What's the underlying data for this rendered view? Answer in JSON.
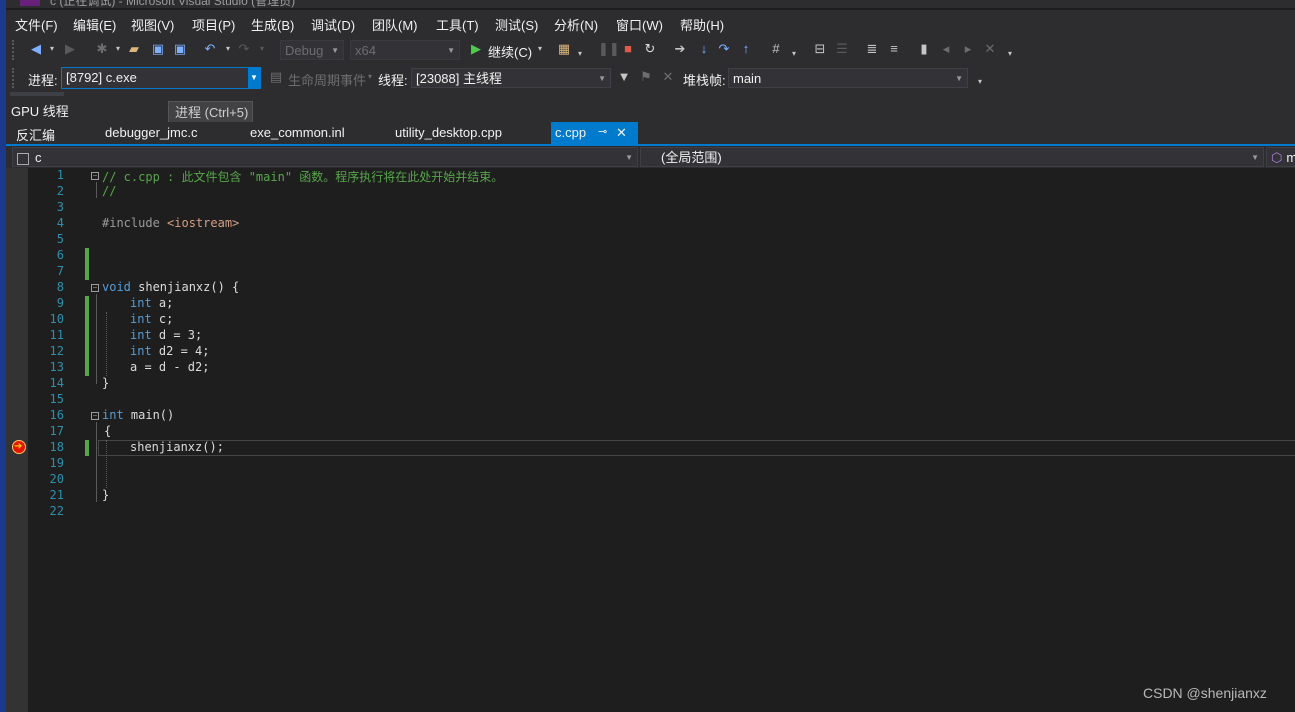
{
  "window": {
    "title": "c (正在调试) - Microsoft Visual Studio (管理员)"
  },
  "menu": [
    "文件(F)",
    "编辑(E)",
    "视图(V)",
    "项目(P)",
    "生成(B)",
    "调试(D)",
    "团队(M)",
    "工具(T)",
    "测试(S)",
    "分析(N)",
    "窗口(W)",
    "帮助(H)"
  ],
  "toolbar": {
    "configuration": "Debug",
    "platform": "x64",
    "continue_label": "继续(C)"
  },
  "debug_location": {
    "process_label": "进程:",
    "process_value": "[8792] c.exe",
    "lifecycle_label": "生命周期事件",
    "thread_label": "线程:",
    "thread_value": "[23088] 主线程",
    "stackframe_label": "堆栈帧:",
    "stackframe_value": "main"
  },
  "gpu_threads_label": "GPU 线程",
  "tooltip": "进程 (Ctrl+5)",
  "tabs": [
    "反汇编",
    "debugger_jmc.c",
    "exe_common.inl",
    "utility_desktop.cpp",
    "c.cpp"
  ],
  "active_tab": "c.cpp",
  "nav": {
    "project": "c",
    "scope": "(全局范围)",
    "member": "m"
  },
  "code": {
    "line_numbers": [
      "1",
      "2",
      "3",
      "4",
      "5",
      "6",
      "7",
      "8",
      "9",
      "10",
      "11",
      "12",
      "13",
      "14",
      "15",
      "16",
      "17",
      "18",
      "19",
      "20",
      "21",
      "22"
    ],
    "line1_comment": "// c.cpp : 此文件包含 \"main\" 函数。程序执行将在此处开始并结束。",
    "line2_comment": "//",
    "line4_include": "#include",
    "line4_header": "<iostream>",
    "kw_void": "void",
    "line8_rest": " shenjianxz() {",
    "kw_int": "int",
    "line9_rest": " a;",
    "line10_rest": " c;",
    "line11_rest": " d = 3;",
    "line12_rest": " d2 = 4;",
    "line13": "a = d - d2;",
    "line14": "}",
    "line16_rest": " main()",
    "line17": "{",
    "line18": "shenjianxz();",
    "line21": "}"
  },
  "watermark": "CSDN @shenjianxz",
  "colors": {
    "accent": "#007acc",
    "keyword": "#569cd6",
    "comment": "#57a64a",
    "line_number": "#2b91af",
    "breakpoint": "#e51400"
  }
}
